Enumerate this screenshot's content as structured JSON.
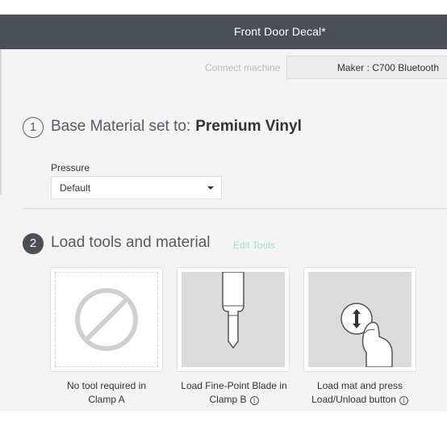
{
  "header": {
    "title": "Front Door Decal*"
  },
  "machine": {
    "connect_text": "Connect machine",
    "selected": "Maker : C700 Bluetooth"
  },
  "step1": {
    "number": "1",
    "prefix": "Base Material set to:",
    "material": "Premium Vinyl",
    "pressure_label": "Pressure",
    "pressure_value": "Default"
  },
  "step2": {
    "number": "2",
    "title": "Load tools and material",
    "edit_tools": "Edit Tools"
  },
  "cards": [
    {
      "line1": "No tool required in",
      "line2": "Clamp A",
      "icon": "no-tool-icon"
    },
    {
      "line1": "Load Fine-Point Blade in",
      "line2": "Clamp B",
      "icon": "fine-point-blade-icon",
      "info": "i"
    },
    {
      "line1": "Load mat and press",
      "line2": "Load/Unload button",
      "icon": "load-unload-button-icon",
      "info": "i"
    }
  ],
  "colors": {
    "header_bg": "#4a5056",
    "accent_teal": "#a5dcd0",
    "content_bg": "#f4f4f5"
  }
}
